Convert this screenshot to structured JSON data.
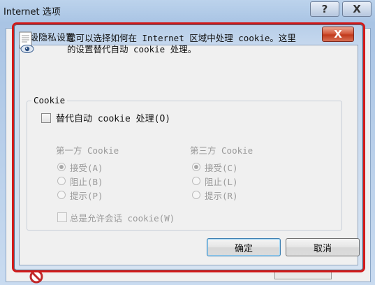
{
  "outer_window": {
    "title": "Internet 选项",
    "help_button": "?",
    "close_button": "X"
  },
  "dialog": {
    "title": "高级隐私设置",
    "close_button": "X",
    "description_line1": "您可以选择如何在 Internet 区域中处理 cookie。这里",
    "description_line2": "的设置替代自动 cookie 处理。",
    "section_label": "Cookie",
    "override_label": "替代自动 cookie 处理(O)",
    "override_checked": false,
    "first_party": {
      "heading": "第一方 Cookie",
      "options": [
        "接受(A)",
        "阻止(B)",
        "提示(P)"
      ],
      "selected": "接受(A)"
    },
    "third_party": {
      "heading": "第三方 Cookie",
      "options": [
        "接受(C)",
        "阻止(L)",
        "提示(R)"
      ],
      "selected": "接受(C)"
    },
    "session_label": "总是允许会话 cookie(W)",
    "session_checked": false,
    "ok_label": "确定",
    "cancel_label": "取消"
  },
  "colors": {
    "highlight_border": "#d11a1a",
    "close_button": "#c13a1c",
    "disabled_text": "#9a9a9a"
  },
  "icons": {
    "dialog_icon": "privacy-document-eye-icon",
    "bottom_icon": "blocked-icon"
  }
}
